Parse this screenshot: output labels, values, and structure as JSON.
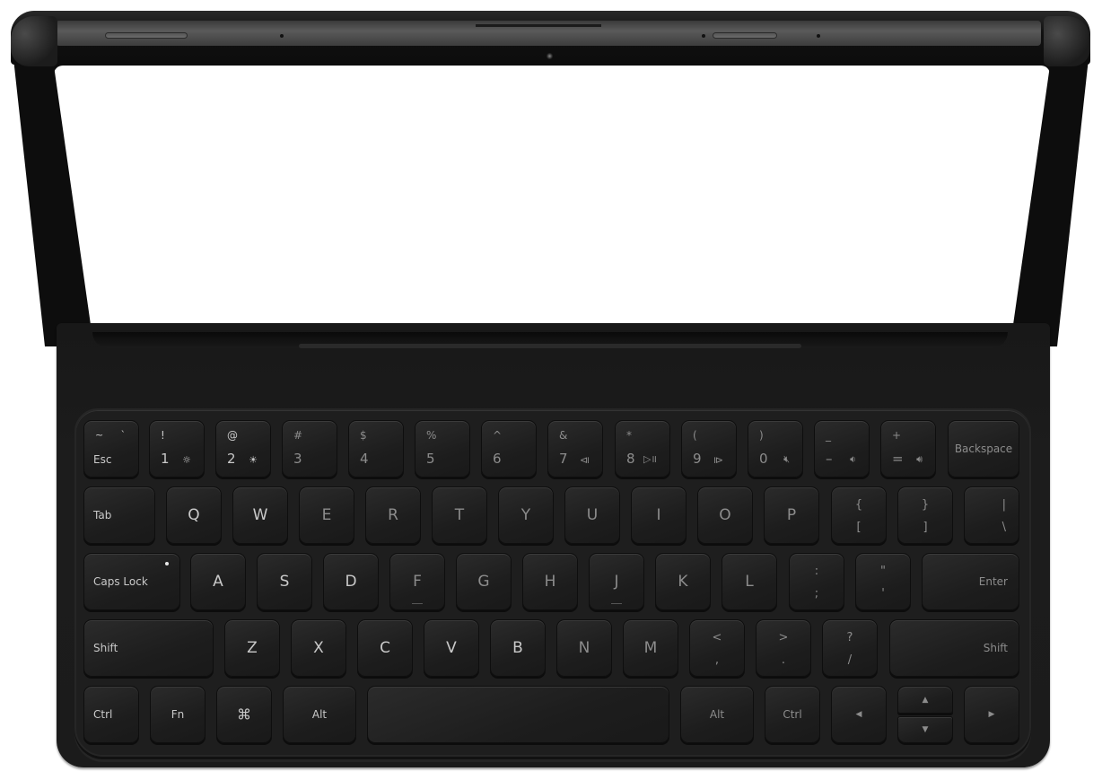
{
  "scene": {
    "description": "Tablet attached to a keyboard cover, top-down view",
    "screen_state": "blank-white",
    "colors": {
      "background": "#ffffff",
      "screen": "#ffffff",
      "frame": "#0d0d0d",
      "keyboard_body": "#1b1b1b",
      "key_face": "#232323",
      "key_legend": "#c9c9c9",
      "caps_lock_indicator": "#e8e8e8"
    }
  },
  "keyboard": {
    "row_number": [
      {
        "id": "esc",
        "top_left": "~",
        "top_right": "`",
        "label": "Esc"
      },
      {
        "id": "1",
        "top": "!",
        "bottom": "1",
        "fn_icon": "☼",
        "fn_name": "brightness-down-icon"
      },
      {
        "id": "2",
        "top": "@",
        "bottom": "2",
        "fn_icon": "☀",
        "fn_name": "brightness-up-icon"
      },
      {
        "id": "3",
        "top": "#",
        "bottom": "3"
      },
      {
        "id": "4",
        "top": "$",
        "bottom": "4"
      },
      {
        "id": "5",
        "top": "%",
        "bottom": "5"
      },
      {
        "id": "6",
        "top": "^",
        "bottom": "6"
      },
      {
        "id": "7",
        "top": "&",
        "bottom": "7",
        "fn_icon": "⧏",
        "fn_name": "previous-track-icon"
      },
      {
        "id": "8",
        "top": "*",
        "bottom": "8",
        "fn_icon": "▷॥",
        "fn_name": "play-pause-icon"
      },
      {
        "id": "9",
        "top": "(",
        "bottom": "9",
        "fn_icon": "⧐",
        "fn_name": "next-track-icon"
      },
      {
        "id": "0",
        "top": ")",
        "bottom": "0",
        "fn_icon": "🔇︎",
        "fn_name": "mute-icon"
      },
      {
        "id": "minus",
        "top": "_",
        "bottom": "–",
        "fn_icon": "🔉︎",
        "fn_name": "volume-down-icon"
      },
      {
        "id": "equals",
        "top": "+",
        "bottom": "=",
        "fn_icon": "🔊︎",
        "fn_name": "volume-up-icon"
      },
      {
        "id": "backspace",
        "label": "Backspace"
      }
    ],
    "row_qwerty": [
      {
        "id": "tab",
        "label": "Tab"
      },
      {
        "id": "q",
        "label": "Q"
      },
      {
        "id": "w",
        "label": "W"
      },
      {
        "id": "e",
        "label": "E"
      },
      {
        "id": "r",
        "label": "R"
      },
      {
        "id": "t",
        "label": "T"
      },
      {
        "id": "y",
        "label": "Y"
      },
      {
        "id": "u",
        "label": "U"
      },
      {
        "id": "i",
        "label": "I"
      },
      {
        "id": "o",
        "label": "O"
      },
      {
        "id": "p",
        "label": "P"
      },
      {
        "id": "lbracket",
        "top": "{",
        "bottom": "["
      },
      {
        "id": "rbracket",
        "top": "}",
        "bottom": "]"
      },
      {
        "id": "backslash",
        "top": "|",
        "bottom": "\\"
      }
    ],
    "row_home": [
      {
        "id": "capslock",
        "label": "Caps Lock"
      },
      {
        "id": "a",
        "label": "A"
      },
      {
        "id": "s",
        "label": "S"
      },
      {
        "id": "d",
        "label": "D"
      },
      {
        "id": "f",
        "label": "F"
      },
      {
        "id": "g",
        "label": "G"
      },
      {
        "id": "h",
        "label": "H"
      },
      {
        "id": "j",
        "label": "J"
      },
      {
        "id": "k",
        "label": "K"
      },
      {
        "id": "l",
        "label": "L"
      },
      {
        "id": "semicolon",
        "top": ":",
        "bottom": ";"
      },
      {
        "id": "quote",
        "top": "\"",
        "bottom": "'"
      },
      {
        "id": "enter",
        "label": "Enter"
      }
    ],
    "row_shift": [
      {
        "id": "lshift",
        "label": "Shift"
      },
      {
        "id": "z",
        "label": "Z"
      },
      {
        "id": "x",
        "label": "X"
      },
      {
        "id": "c",
        "label": "C"
      },
      {
        "id": "v",
        "label": "V"
      },
      {
        "id": "b",
        "label": "B"
      },
      {
        "id": "n",
        "label": "N"
      },
      {
        "id": "m",
        "label": "M"
      },
      {
        "id": "comma",
        "top": "<",
        "bottom": ","
      },
      {
        "id": "period",
        "top": ">",
        "bottom": "."
      },
      {
        "id": "slash",
        "top": "?",
        "bottom": "/"
      },
      {
        "id": "rshift",
        "label": "Shift"
      }
    ],
    "row_bottom": [
      {
        "id": "lctrl",
        "label": "Ctrl"
      },
      {
        "id": "fn",
        "label": "Fn"
      },
      {
        "id": "cmd",
        "label": "⌘"
      },
      {
        "id": "lalt",
        "label": "Alt"
      },
      {
        "id": "space",
        "label": ""
      },
      {
        "id": "ralt",
        "label": "Alt"
      },
      {
        "id": "rctrl",
        "label": "Ctrl"
      },
      {
        "id": "left",
        "label": "◀"
      },
      {
        "id": "up",
        "label": "▲"
      },
      {
        "id": "down",
        "label": "▼"
      },
      {
        "id": "right",
        "label": "▶"
      }
    ]
  }
}
